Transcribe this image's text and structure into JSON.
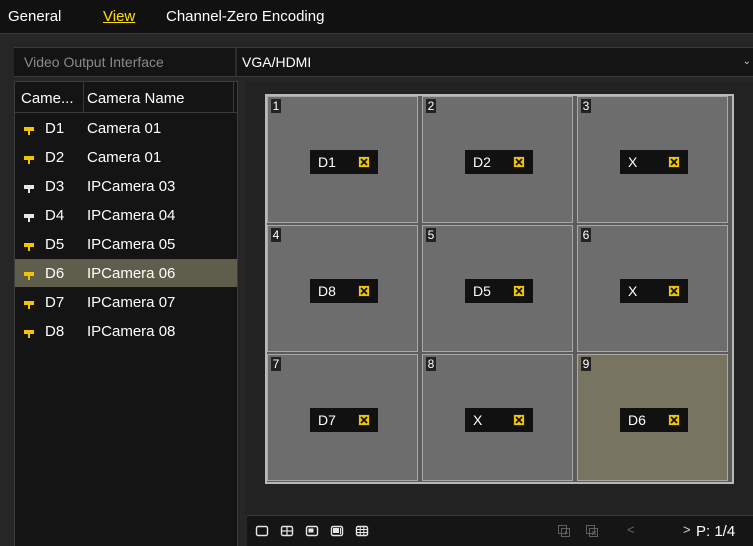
{
  "tabs": [
    {
      "label": "General"
    },
    {
      "label": "View"
    },
    {
      "label": "Channel-Zero Encoding"
    }
  ],
  "active_tab": "View",
  "output": {
    "label": "Video Output Interface",
    "value": "VGA/HDMI"
  },
  "camera_list": {
    "col_no": "Came...",
    "col_name": "Camera Name",
    "cameras": [
      {
        "id": "D1",
        "name": "Camera 01",
        "status": "online"
      },
      {
        "id": "D2",
        "name": "Camera 01",
        "status": "online"
      },
      {
        "id": "D3",
        "name": "IPCamera 03",
        "status": "offline"
      },
      {
        "id": "D4",
        "name": "IPCamera 04",
        "status": "offline"
      },
      {
        "id": "D5",
        "name": "IPCamera 05",
        "status": "online"
      },
      {
        "id": "D6",
        "name": "IPCamera 06",
        "status": "online",
        "selected": true
      },
      {
        "id": "D7",
        "name": "IPCamera 07",
        "status": "online"
      },
      {
        "id": "D8",
        "name": "IPCamera 08",
        "status": "online"
      }
    ]
  },
  "grid": {
    "cells": [
      {
        "number": "1",
        "assigned": "D1"
      },
      {
        "number": "2",
        "assigned": "D2"
      },
      {
        "number": "3",
        "assigned": "X"
      },
      {
        "number": "4",
        "assigned": "D8"
      },
      {
        "number": "5",
        "assigned": "D5"
      },
      {
        "number": "6",
        "assigned": "X"
      },
      {
        "number": "7",
        "assigned": "D7"
      },
      {
        "number": "8",
        "assigned": "X"
      },
      {
        "number": "9",
        "assigned": "D6",
        "selected": true
      }
    ]
  },
  "toolbar": {
    "layout_icons": [
      "single-layout-icon",
      "quad-layout-icon",
      "six-layout-icon",
      "eight-layout-icon",
      "nine-layout-icon"
    ],
    "prev_label": "<",
    "next_label": ">",
    "page": "P: 1/4"
  },
  "colors": {
    "accent": "#ffe100",
    "online_icon": "#f2c500",
    "selected_row": "#5f5d4b",
    "selected_cell": "#77755f"
  }
}
